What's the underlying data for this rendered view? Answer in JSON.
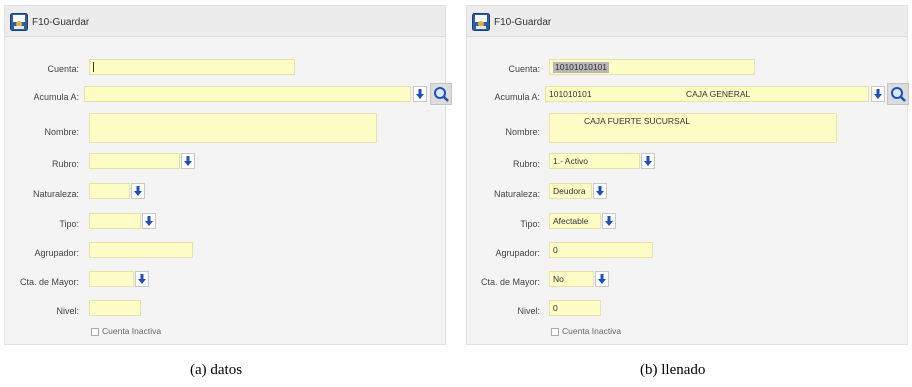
{
  "toolbar": {
    "save_label": "F10-Guardar"
  },
  "labels": {
    "cuenta": "Cuenta:",
    "acumula": "Acumula A:",
    "nombre": "Nombre:",
    "rubro": "Rubro:",
    "naturaleza": "Naturaleza:",
    "tipo": "Tipo:",
    "agrupador": "Agrupador:",
    "cta_mayor": "Cta. de Mayor:",
    "nivel": "Nivel:",
    "inactiva": "Cuenta Inactiva"
  },
  "panel_b": {
    "cuenta": "10101010101",
    "acumula_code": "101010101",
    "acumula_name": "CAJA GENERAL",
    "nombre": "CAJA FUERTE SUCURSAL",
    "rubro": "1.- Activo",
    "naturaleza": "Deudora",
    "tipo": "Afectable",
    "agrupador": "0",
    "cta_mayor": "No",
    "nivel": "0"
  },
  "captions": {
    "a": "(a)  datos",
    "b": "(b)  llenado"
  },
  "colors": {
    "field": "#fffdc6",
    "arrow": "#1f4fbf",
    "panel": "#f4f4f4"
  }
}
